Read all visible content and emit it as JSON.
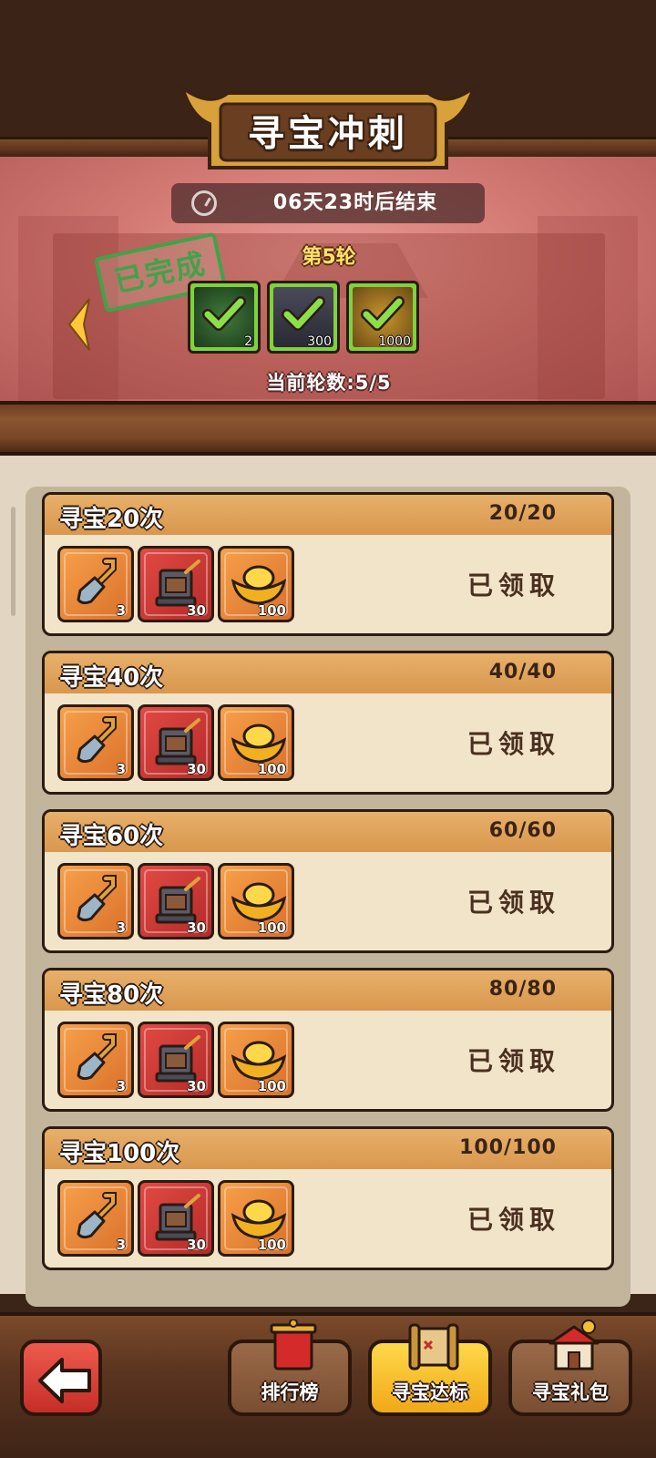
{
  "header": {
    "title": "寻宝冲刺",
    "timer_text": "06天23时后结束"
  },
  "round": {
    "title": "第5轮",
    "stamp": "已完成",
    "progress": "当前轮数:5/5",
    "rewards": [
      {
        "icon": "jade-dragon-icon",
        "count": "2",
        "claimed": true
      },
      {
        "icon": "anvil-chest-icon",
        "count": "300",
        "claimed": true
      },
      {
        "icon": "gold-ingot-icon",
        "count": "1000",
        "claimed": true
      }
    ]
  },
  "tasks": [
    {
      "title": "寻宝20次",
      "progress": "20/20",
      "status": "已领取",
      "rewards": [
        {
          "icon": "shovel-icon",
          "qty": "3"
        },
        {
          "icon": "anvil-chest-icon",
          "qty": "30"
        },
        {
          "icon": "gold-ingot-icon",
          "qty": "100"
        }
      ]
    },
    {
      "title": "寻宝40次",
      "progress": "40/40",
      "status": "已领取",
      "rewards": [
        {
          "icon": "shovel-icon",
          "qty": "3"
        },
        {
          "icon": "anvil-chest-icon",
          "qty": "30"
        },
        {
          "icon": "gold-ingot-icon",
          "qty": "100"
        }
      ]
    },
    {
      "title": "寻宝60次",
      "progress": "60/60",
      "status": "已领取",
      "rewards": [
        {
          "icon": "shovel-icon",
          "qty": "3"
        },
        {
          "icon": "anvil-chest-icon",
          "qty": "30"
        },
        {
          "icon": "gold-ingot-icon",
          "qty": "100"
        }
      ]
    },
    {
      "title": "寻宝80次",
      "progress": "80/80",
      "status": "已领取",
      "rewards": [
        {
          "icon": "shovel-icon",
          "qty": "3"
        },
        {
          "icon": "anvil-chest-icon",
          "qty": "30"
        },
        {
          "icon": "gold-ingot-icon",
          "qty": "100"
        }
      ]
    },
    {
      "title": "寻宝100次",
      "progress": "100/100",
      "status": "已领取",
      "rewards": [
        {
          "icon": "shovel-icon",
          "qty": "3"
        },
        {
          "icon": "anvil-chest-icon",
          "qty": "30"
        },
        {
          "icon": "gold-ingot-icon",
          "qty": "100"
        }
      ]
    }
  ],
  "nav": {
    "leaderboard": "排行榜",
    "treasure_goal": "寻宝达标",
    "treasure_pack": "寻宝礼包",
    "active": "寻宝达标"
  },
  "colors": {
    "accent_gold": "#f0a818",
    "check_green": "#7ed33a",
    "card_bg": "#f2e4c8"
  }
}
